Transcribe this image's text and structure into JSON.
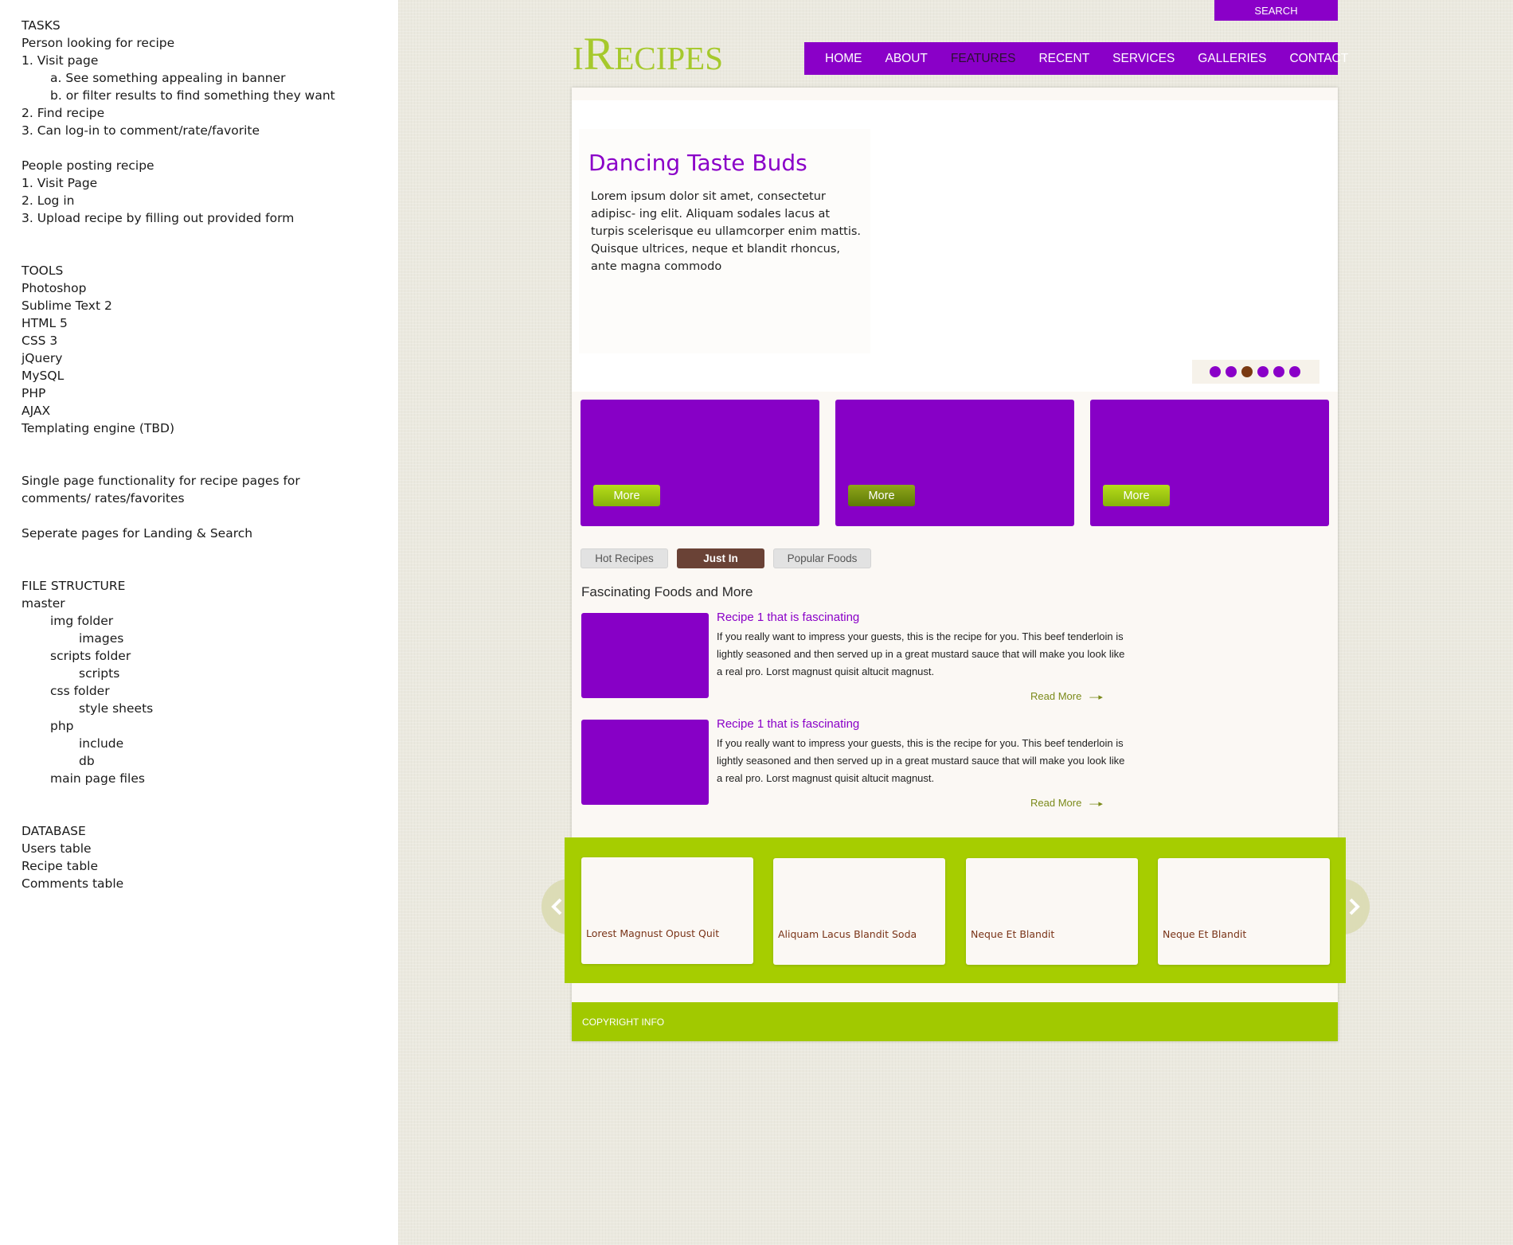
{
  "notes": {
    "tasks_heading": "TASKS",
    "person_looking": "Person looking for recipe",
    "step1": "1. Visit page",
    "step1a": "a. See something appealing in banner",
    "step1b": "b. or filter results to find something they want",
    "step2": "2. Find recipe",
    "step3": "3. Can log-in to comment/rate/favorite",
    "people_posting": "People posting recipe",
    "post1": "1. Visit Page",
    "post2": "2. Log in",
    "post3": "3. Upload recipe by filling out provided form",
    "tools_heading": "TOOLS",
    "tools": [
      "Photoshop",
      "Sublime Text 2",
      "HTML 5",
      "CSS 3",
      "jQuery",
      "MySQL",
      "PHP",
      "AJAX",
      "Templating engine (TBD)"
    ],
    "single_page": "Single page functionality for recipe pages for comments/ rates/favorites",
    "separate_pages": "Seperate pages for Landing & Search",
    "file_structure_heading": "FILE STRUCTURE",
    "fs_master": "master",
    "fs_img": "img folder",
    "fs_images": "images",
    "fs_scripts_folder": "scripts folder",
    "fs_scripts": "scripts",
    "fs_css": "css folder",
    "fs_stylesheets": "style sheets",
    "fs_php": "php",
    "fs_include": "include",
    "fs_db": "db",
    "fs_main": "main page files",
    "database_heading": "DATABASE",
    "db_users": "Users table",
    "db_recipe": "Recipe table",
    "db_comments": "Comments table"
  },
  "header": {
    "search_label": "SEARCH",
    "logo": "iRecipes",
    "nav": [
      "HOME",
      "ABOUT",
      "FEATURES",
      "RECENT",
      "SERVICES",
      "GALLERIES",
      "CONTACT"
    ],
    "active_nav": "FEATURES"
  },
  "banner": {
    "title": "Dancing Taste Buds",
    "body": "Lorem ipsum dolor sit amet, consectetur adipisc- ing elit. Aliquam sodales lacus at turpis scelerisque eu ullamcorper enim mattis. Quisque ultrices, neque et blandit rhoncus, ante magna commodo",
    "slide_count": 6,
    "active_slide": 3
  },
  "features": [
    {
      "button_label": "More"
    },
    {
      "button_label": "More"
    },
    {
      "button_label": "More"
    }
  ],
  "tabs": {
    "hot": "Hot Recipes",
    "just_in": "Just In",
    "popular": "Popular Foods",
    "active": "Just In"
  },
  "section_title": "Fascinating Foods and More",
  "recipes": [
    {
      "title": "Recipe 1 that is fascinating",
      "body": "If you really want to impress your guests, this is the recipe for you. This beef tenderloin is lightly seasoned and then served up in a great mustard sauce that will make you look like a real pro. Lorst magnust quisit altucit magnust.",
      "read_more": "Read More"
    },
    {
      "title": "Recipe 1 that is fascinating",
      "body": "If you really want to impress your guests, this is the recipe for you. This beef tenderloin is lightly seasoned and then served up in a great mustard sauce that will make you look like a real pro. Lorst magnust quisit altucit magnust.",
      "read_more": "Read More"
    }
  ],
  "carousel": [
    "Lorest Magnust Opust Quit",
    "Aliquam Lacus Blandit Soda",
    "Neque Et Blandit",
    "Neque Et Blandit"
  ],
  "footer": "COPYRIGHT INFO",
  "colors": {
    "purple": "#8a00c8",
    "green": "#a6cd00",
    "brown": "#6a4236",
    "canvas": "#ebe9df"
  }
}
